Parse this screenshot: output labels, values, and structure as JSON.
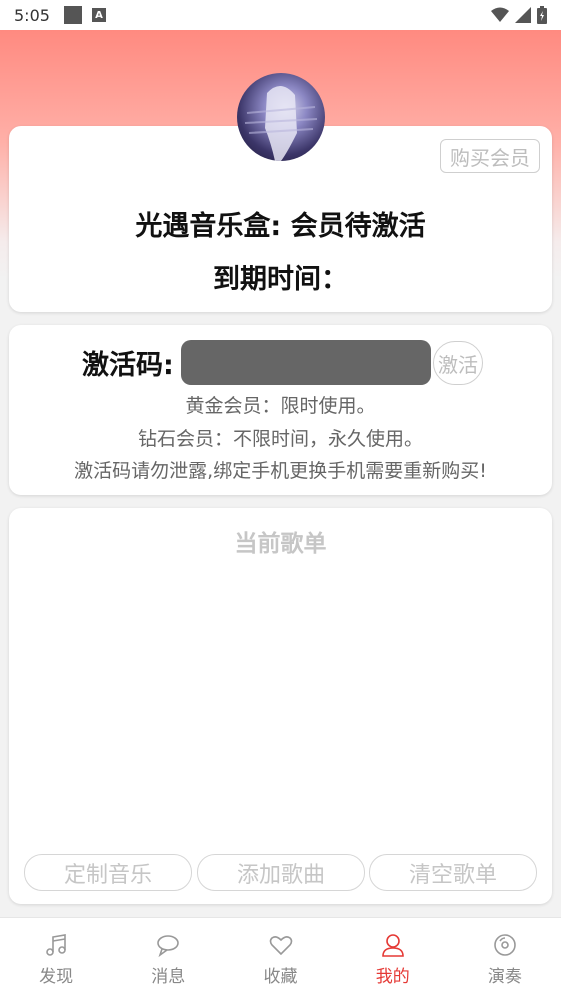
{
  "status_bar": {
    "time": "5:05",
    "a_badge": "A"
  },
  "header": {
    "buy_button": "购买会员"
  },
  "membership": {
    "title": "光遇音乐盒: 会员待激活",
    "expire_label": "到期时间："
  },
  "activation": {
    "label": "激活码:",
    "input_value": "",
    "activate_button": "激活",
    "info": [
      "黄金会员：限时使用。",
      "钻石会员：不限时间，永久使用。",
      "激活码请勿泄露,绑定手机更换手机需要重新购买!"
    ]
  },
  "playlist": {
    "title": "当前歌单",
    "buttons": [
      "定制音乐",
      "添加歌曲",
      "清空歌单"
    ]
  },
  "tabs": [
    {
      "label": "发现",
      "icon": "music-note-icon"
    },
    {
      "label": "消息",
      "icon": "chat-bubble-icon"
    },
    {
      "label": "收藏",
      "icon": "heart-icon"
    },
    {
      "label": "我的",
      "icon": "user-icon",
      "active": true
    },
    {
      "label": "演奏",
      "icon": "disc-icon"
    }
  ],
  "colors": {
    "accent": "#e53935",
    "header_gradient_top": "#ff8a80",
    "code_input_bg": "#666666"
  }
}
